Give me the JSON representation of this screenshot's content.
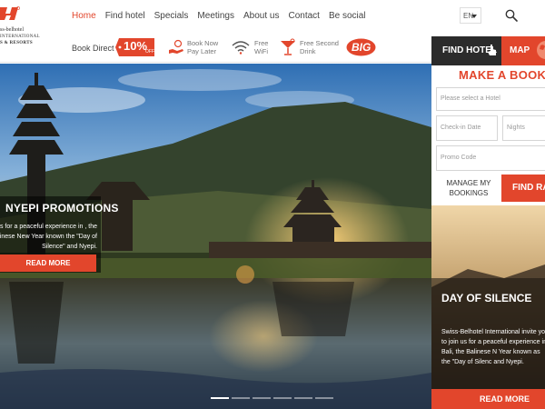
{
  "logo": {
    "line1": "ss-belhotel",
    "line2": "INTERNATIONAL",
    "line3": "S & RESORTS"
  },
  "nav": {
    "items": [
      {
        "label": "Home",
        "active": true
      },
      {
        "label": "Find hotel"
      },
      {
        "label": "Specials"
      },
      {
        "label": "Meetings"
      },
      {
        "label": "About us"
      },
      {
        "label": "Contact"
      },
      {
        "label": "Be social"
      }
    ],
    "language": "EN"
  },
  "benefits": {
    "book_direct": "Book Direct",
    "discount": "10%",
    "discount_suffix": "OFF",
    "pay_later": "Book Now\nPay Later",
    "wifi": "Free\nWiFi",
    "drink": "Free Second\nDrink",
    "big": "BIG"
  },
  "hero": {
    "promo_title": "NYEPI PROMOTIONS",
    "promo_text": "us for a peaceful experience in , the Balinese New Year known the \"Day of Silence\" and Nyepi.",
    "promo_button": "READ MORE",
    "slides": 6,
    "active_slide": 1
  },
  "booking": {
    "tab_find": "FIND HOTEL",
    "tab_map": "MAP",
    "heading": "MAKE A BOOKING",
    "hotel_placeholder": "Please select a Hotel",
    "checkin_placeholder": "Check-in Date",
    "nights_placeholder": "Nights",
    "promo_placeholder": "Promo Code",
    "manage_label": "MANAGE MY BOOKINGS",
    "find_rate_label": "FIND RAT"
  },
  "side_promo": {
    "title": "DAY OF SILENCE",
    "text": "Swiss-Belhotel International invite you to join us for a peaceful experience in Bali, the Balinese N Year known as the \"Day of Silenc and Nyepi.",
    "button": "READ MORE"
  },
  "colors": {
    "accent": "#e2462c",
    "dark": "#2b2b2b"
  }
}
